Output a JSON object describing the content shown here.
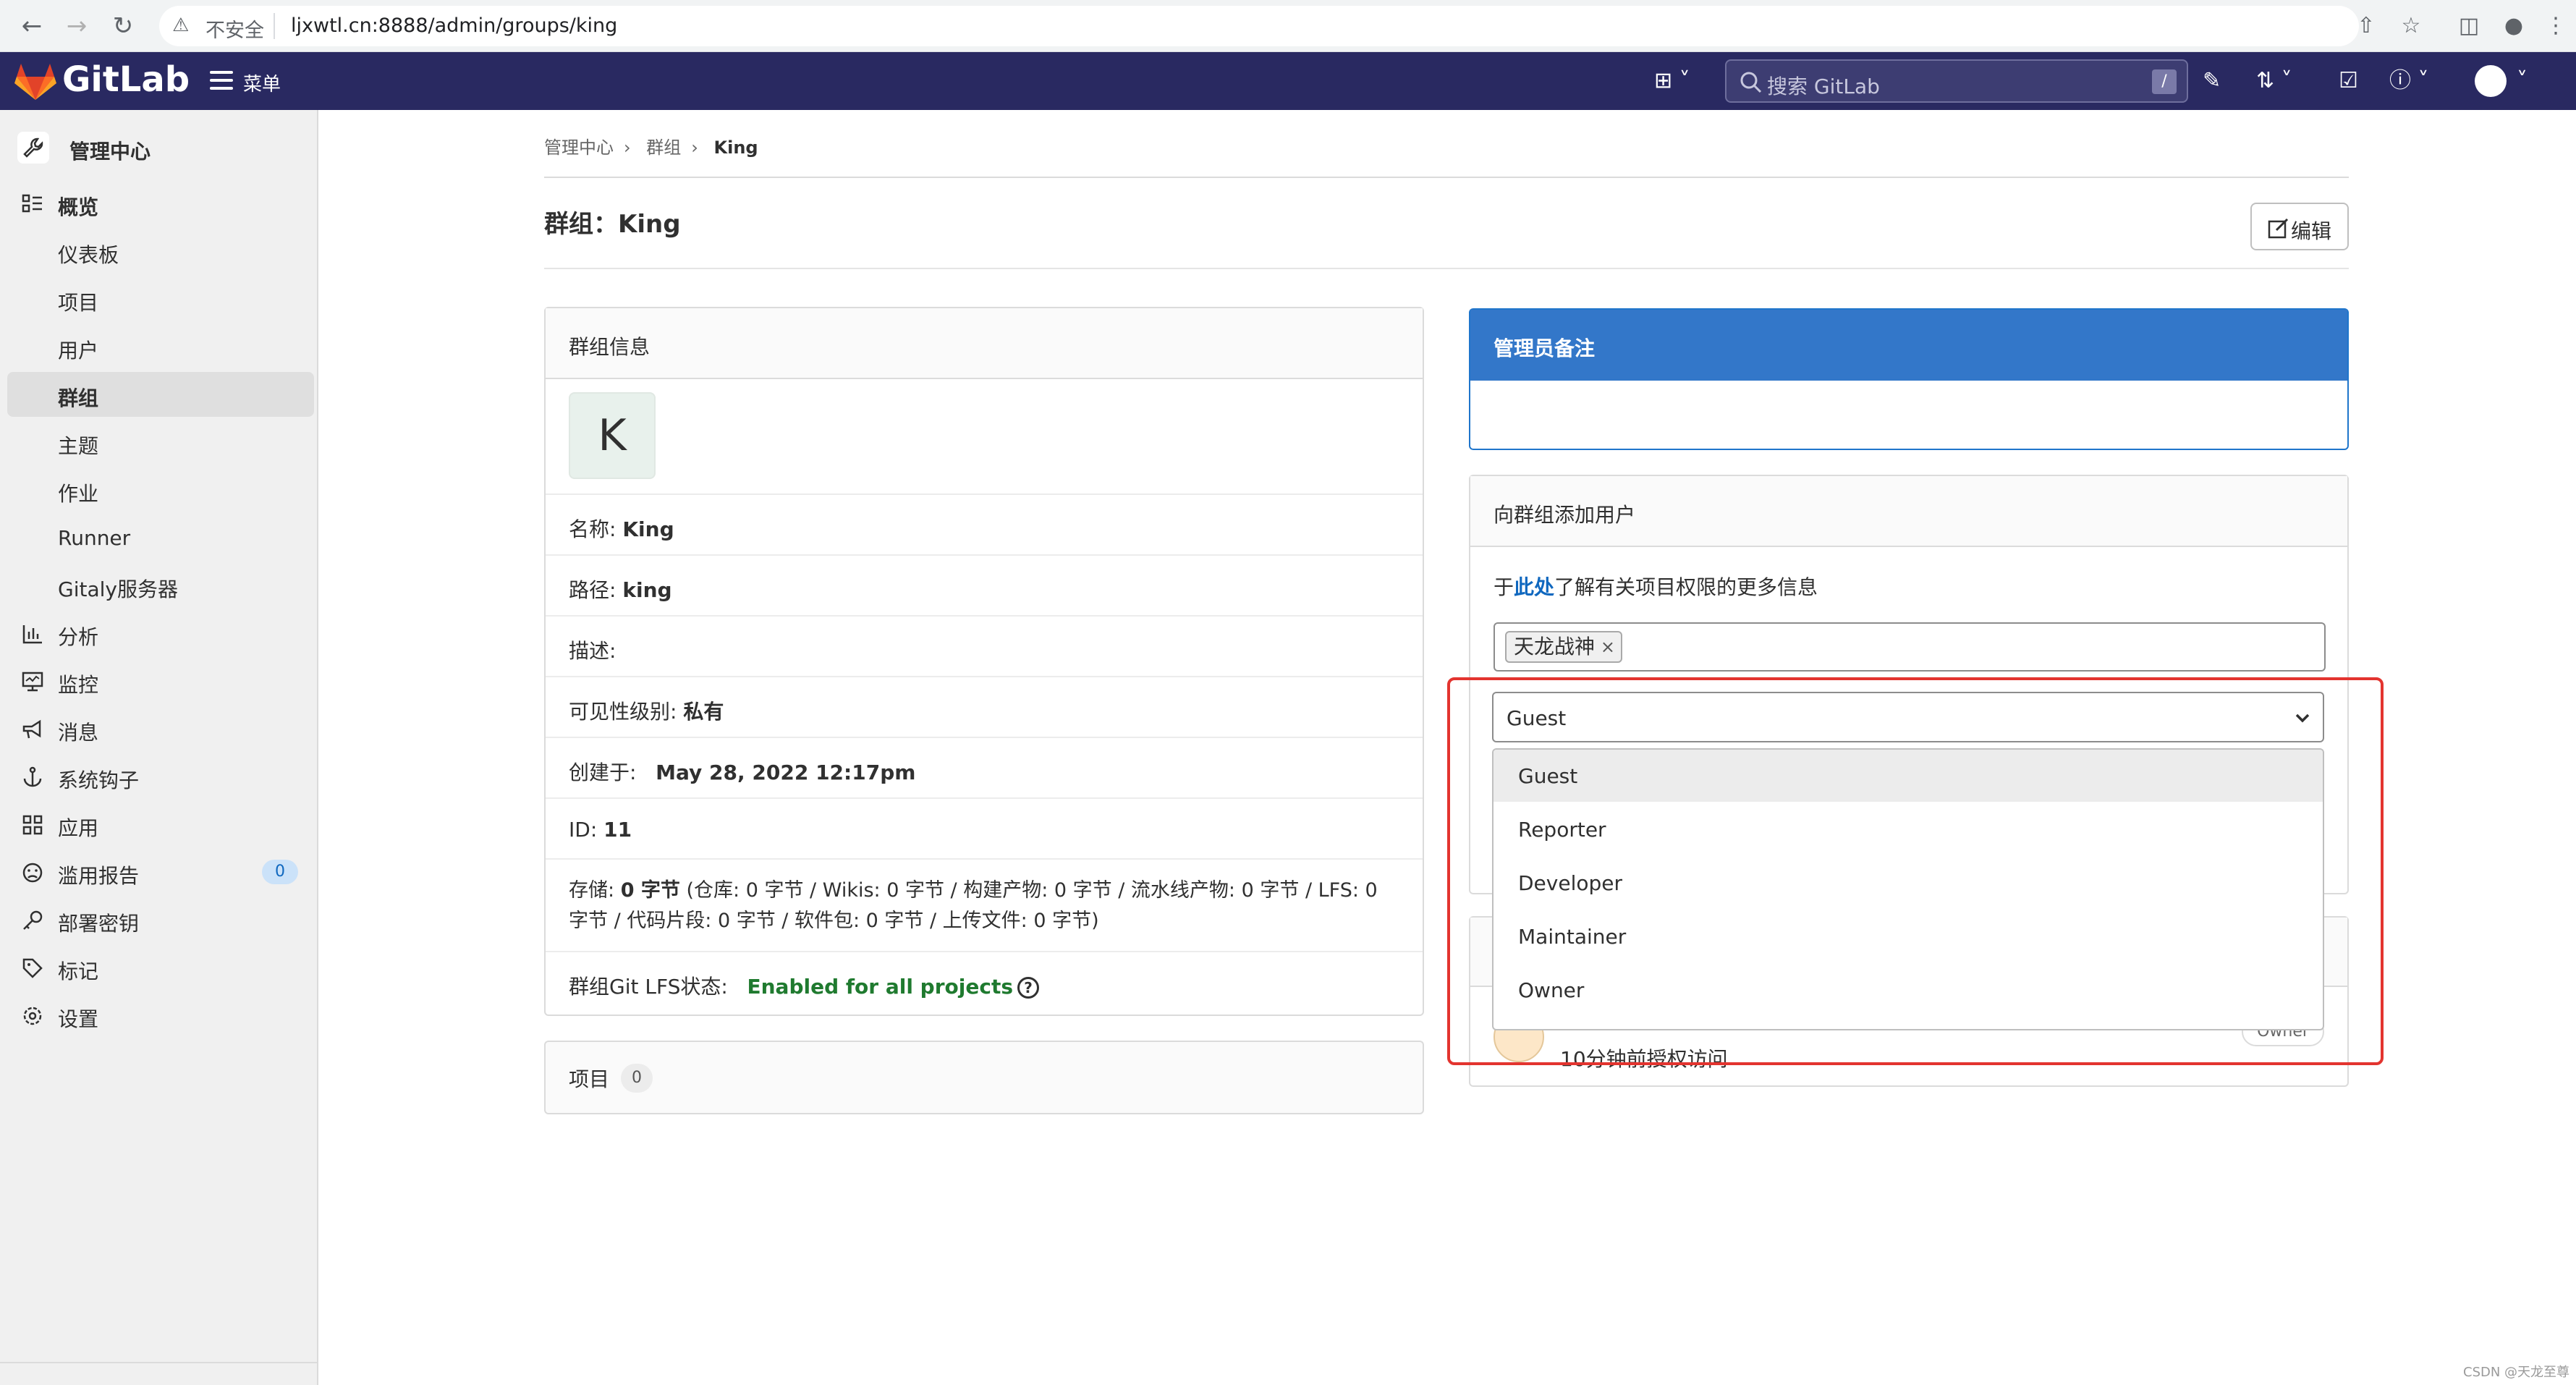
{
  "browser": {
    "insecure_label": "不安全",
    "url": "ljxwtl.cn:8888/admin/groups/king"
  },
  "header": {
    "brand": "GitLab",
    "menu_label": "菜单",
    "search_placeholder": "搜索 GitLab",
    "search_shortcut": "/"
  },
  "sidebar": {
    "title": "管理中心",
    "items": [
      {
        "label": "概览",
        "icon": "overview-icon",
        "bold": true
      },
      {
        "label": "仪表板",
        "sub": true
      },
      {
        "label": "项目",
        "sub": true
      },
      {
        "label": "用户",
        "sub": true
      },
      {
        "label": "群组",
        "sub": true,
        "active": true
      },
      {
        "label": "主题",
        "sub": true
      },
      {
        "label": "作业",
        "sub": true
      },
      {
        "label": "Runner",
        "sub": true
      },
      {
        "label": "Gitaly服务器",
        "sub": true
      },
      {
        "label": "分析",
        "icon": "chart-icon"
      },
      {
        "label": "监控",
        "icon": "monitor-icon"
      },
      {
        "label": "消息",
        "icon": "megaphone-icon"
      },
      {
        "label": "系统钩子",
        "icon": "anchor-icon"
      },
      {
        "label": "应用",
        "icon": "apps-icon"
      },
      {
        "label": "滥用报告",
        "icon": "abuse-icon",
        "badge": "0"
      },
      {
        "label": "部署密钥",
        "icon": "key-icon"
      },
      {
        "label": "标记",
        "icon": "label-icon"
      },
      {
        "label": "设置",
        "icon": "settings-icon"
      }
    ]
  },
  "breadcrumb": [
    "管理中心",
    "群组",
    "King"
  ],
  "page": {
    "title": "群组：King",
    "edit_label": "编辑"
  },
  "group_info": {
    "header": "群组信息",
    "avatar_letter": "K",
    "name_label": "名称:",
    "name_value": "King",
    "path_label": "路径:",
    "path_value": "king",
    "description_label": "描述:",
    "visibility_label": "可见性级别:",
    "visibility_value": "私有",
    "created_label": "创建于:",
    "created_value": "May 28, 2022 12:17pm",
    "id_label": "ID:",
    "id_value": "11",
    "storage_label": "存储:",
    "storage_value": "0 字节",
    "storage_detail_1": "(仓库: 0 字节 / Wikis: 0 字节 / 构建产物: 0 字节 / 流水线产物:  0 字节 / LFS: 0",
    "storage_detail_2": "字节 / 代码片段: 0 字节 / 软件包: 0 字节 / 上传文件: 0 字节)",
    "lfs_label": "群组Git LFS状态:",
    "lfs_value": "Enabled for all projects"
  },
  "projects_card": {
    "label": "项目",
    "count": "0"
  },
  "admin_note": {
    "header": "管理员备注"
  },
  "add_users": {
    "header": "向群组添加用户",
    "help_prefix": "于",
    "help_link": "此处",
    "help_suffix": "了解有关项目权限的更多信息",
    "selected_user": "天龙战神",
    "role_selected": "Guest",
    "role_options": [
      "Guest",
      "Reporter",
      "Developer",
      "Maintainer",
      "Owner"
    ]
  },
  "members": {
    "time": "10分钟前授权访问",
    "role": "Owner"
  },
  "watermark": "CSDN @天龙至尊"
}
